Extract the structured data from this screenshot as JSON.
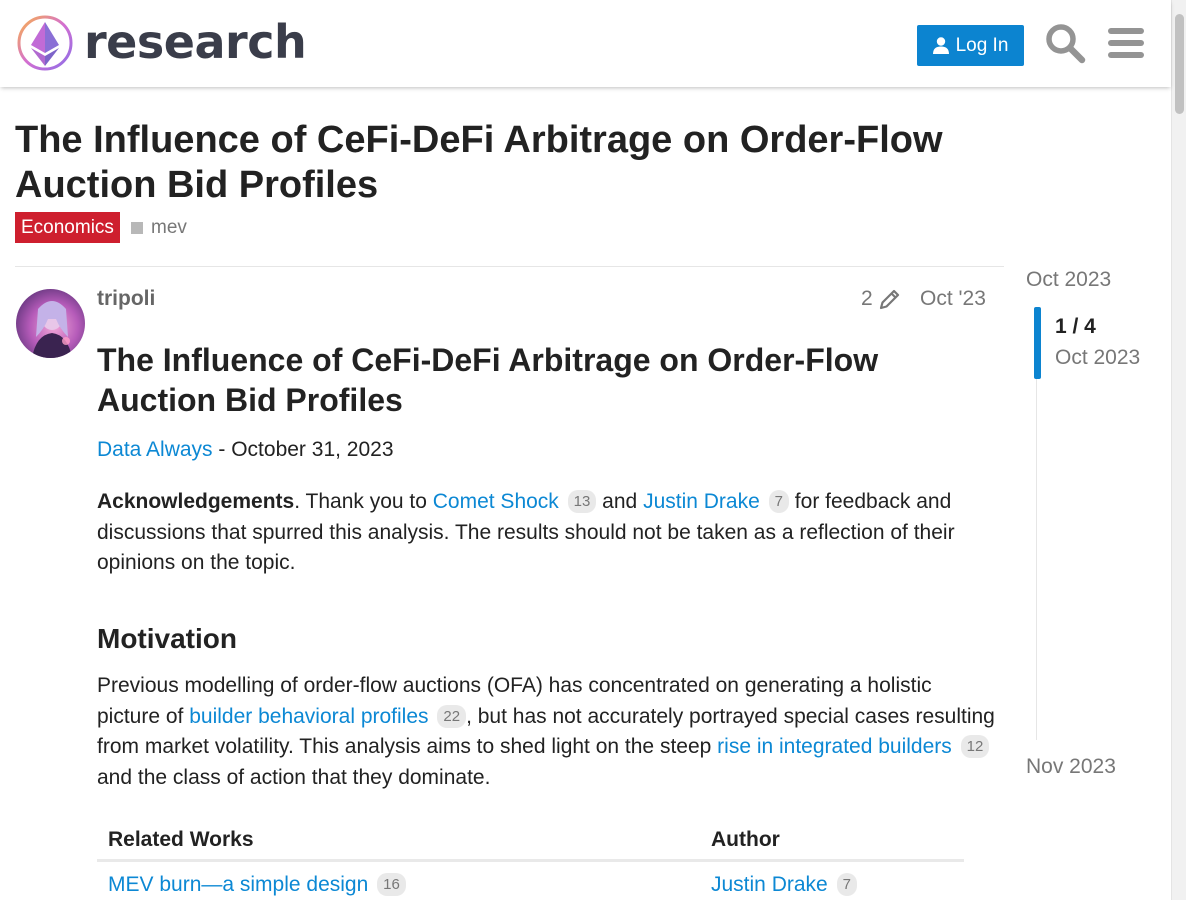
{
  "header": {
    "site_name": "research",
    "login_label": "Log In",
    "icons": [
      "ethereum-logo",
      "user-icon",
      "search-icon",
      "hamburger-menu-icon"
    ]
  },
  "topic": {
    "title": "The Influence of CeFi-DeFi Arbitrage on Order-Flow Auction Bid Profiles",
    "category": "Economics",
    "category_color": "#ce1f2e",
    "tag": "mev"
  },
  "post": {
    "username": "tripoli",
    "edit_count": "2",
    "date": "Oct '23",
    "heading": "The Influence of CeFi-DeFi Arbitrage on Order-Flow Auction Bid Profiles",
    "byline": {
      "author_link": "Data Always",
      "date_text": " - October 31, 2023"
    },
    "acknowledgements": {
      "label": "Acknowledgements",
      "text1": ". Thank you to ",
      "link1": "Comet Shock",
      "count1": "13",
      "text2": " and ",
      "link2": "Justin Drake",
      "count2": "7",
      "text3": " for feedback and discussions that spurred this analysis. The results should not be taken as a reflection of their opinions on the topic."
    },
    "motivation": {
      "heading": "Motivation",
      "text1": "Previous modelling of order-flow auctions (OFA) has concentrated on generating a holistic picture of ",
      "link1": "builder behavioral profiles",
      "count1": "22",
      "text2": ", but has not accurately portrayed special cases resulting from market volatility. This analysis aims to shed light on the steep ",
      "link2": "rise in integrated builders",
      "count2": "12",
      "text3": " and the class of action that they dominate."
    },
    "related_table": {
      "headers": [
        "Related Works",
        "Author"
      ],
      "rows": [
        {
          "work": "MEV burn—a simple design",
          "work_count": "16",
          "author": "Justin Drake",
          "author_count": "7"
        }
      ]
    }
  },
  "timeline": {
    "start": "Oct 2023",
    "position": "1 / 4",
    "current_date": "Oct 2023",
    "end": "Nov 2023"
  },
  "colors": {
    "accent": "#0c84d0",
    "link": "#0c88d4"
  }
}
